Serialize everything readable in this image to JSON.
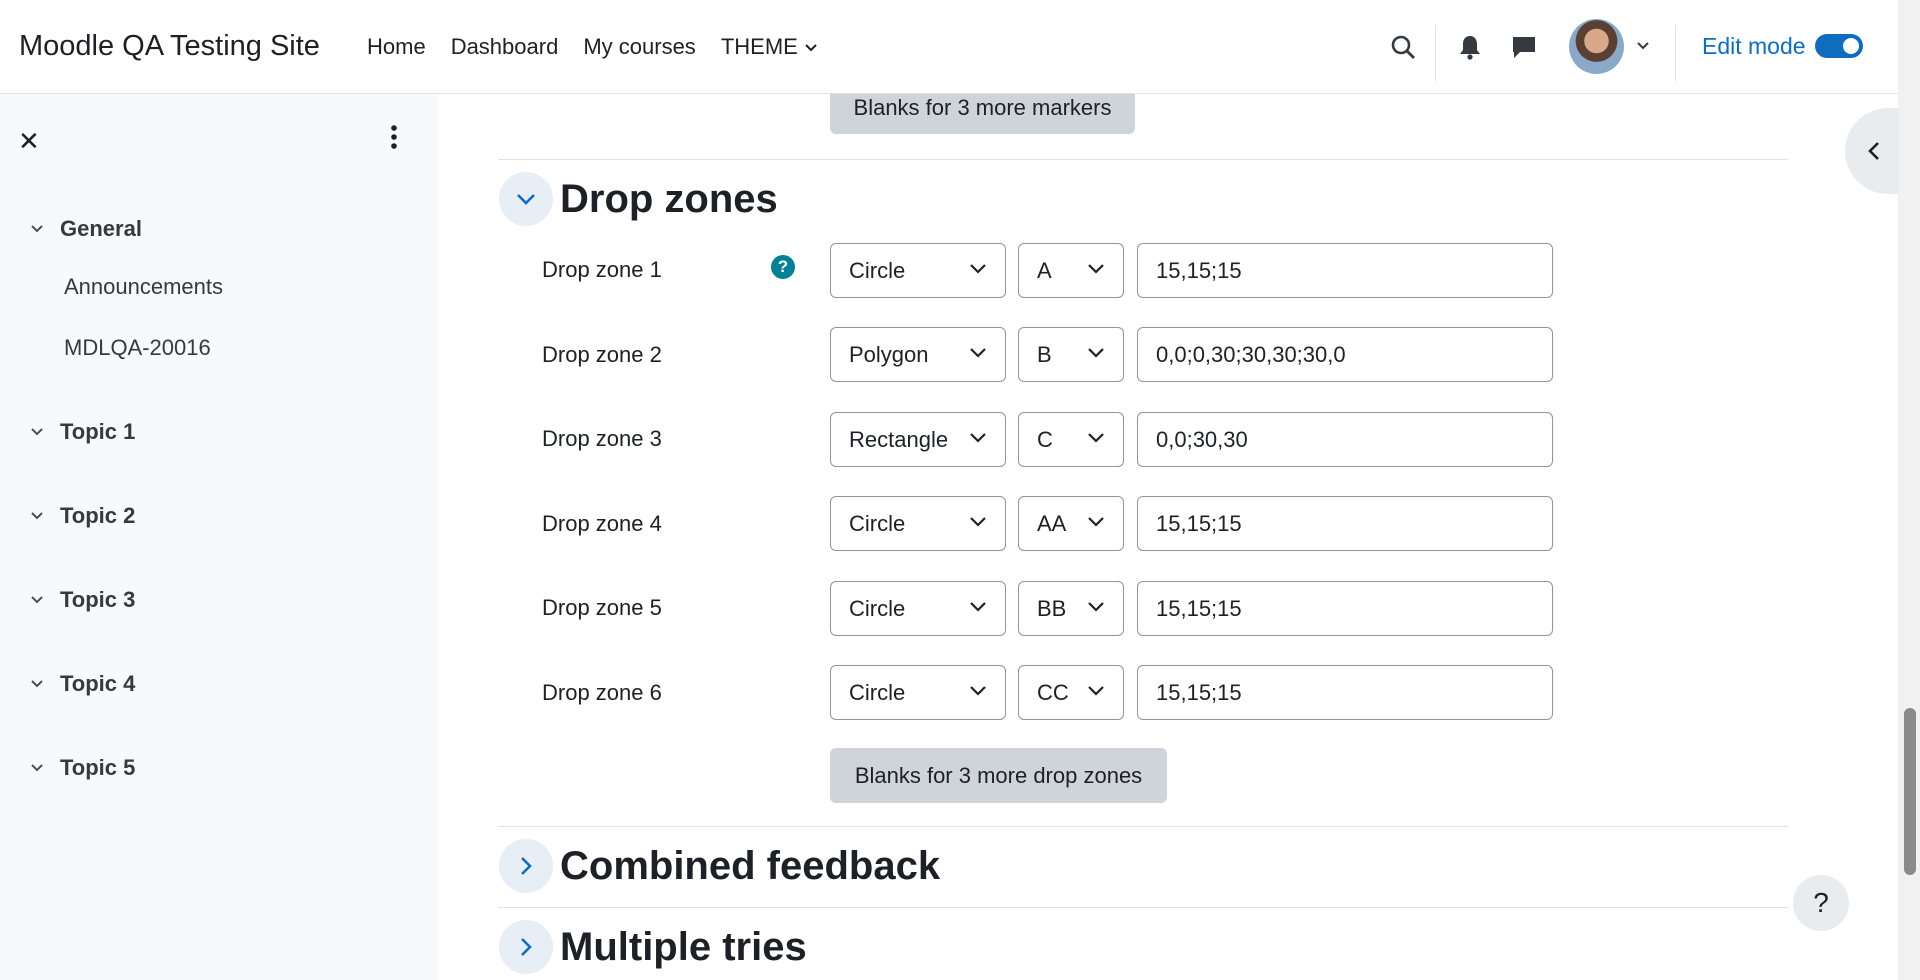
{
  "navbar": {
    "site_name": "Moodle QA Testing Site",
    "links": [
      "Home",
      "Dashboard",
      "My courses",
      "THEME"
    ],
    "edit_mode_label": "Edit mode",
    "edit_mode_on": true,
    "icons": [
      "search-icon",
      "bell-icon",
      "chat-icon",
      "avatar",
      "chevron-down-icon"
    ]
  },
  "drawer": {
    "sections": [
      {
        "label": "General",
        "items": [
          "Announcements",
          "MDLQA-20016"
        ]
      },
      {
        "label": "Topic 1",
        "items": []
      },
      {
        "label": "Topic 2",
        "items": []
      },
      {
        "label": "Topic 3",
        "items": []
      },
      {
        "label": "Topic 4",
        "items": []
      },
      {
        "label": "Topic 5",
        "items": []
      }
    ]
  },
  "main": {
    "markers_button": "Blanks for 3 more markers",
    "drop_zones": {
      "title": "Drop zones",
      "rows": [
        {
          "label": "Drop zone 1",
          "shape": "Circle",
          "marker": "A",
          "coords": "15,15;15"
        },
        {
          "label": "Drop zone 2",
          "shape": "Polygon",
          "marker": "B",
          "coords": "0,0;0,30;30,30;30,0"
        },
        {
          "label": "Drop zone 3",
          "shape": "Rectangle",
          "marker": "C",
          "coords": "0,0;30,30"
        },
        {
          "label": "Drop zone 4",
          "shape": "Circle",
          "marker": "AA",
          "coords": "15,15;15"
        },
        {
          "label": "Drop zone 5",
          "shape": "Circle",
          "marker": "BB",
          "coords": "15,15;15"
        },
        {
          "label": "Drop zone 6",
          "shape": "Circle",
          "marker": "CC",
          "coords": "15,15;15"
        }
      ],
      "more_button": "Blanks for 3 more drop zones"
    },
    "combined_feedback_title": "Combined feedback",
    "multiple_tries_title": "Multiple tries",
    "help_glyph": "?",
    "float_help_glyph": "?"
  },
  "colors": {
    "accent": "#0f6cbf",
    "help": "#008196",
    "button_grey": "#ced4da"
  }
}
